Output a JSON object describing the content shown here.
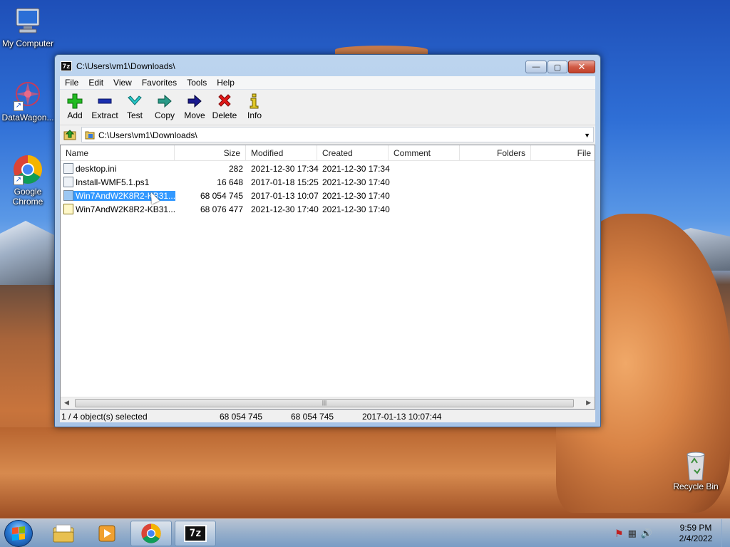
{
  "desktop": {
    "icons": [
      {
        "label": "My Computer",
        "icon": "computer-icon"
      },
      {
        "label": "DataWagon...",
        "icon": "datawagon-icon"
      },
      {
        "label": "Google Chrome",
        "icon": "chrome-icon"
      },
      {
        "label": "Recycle Bin",
        "icon": "recycle-bin-icon"
      }
    ]
  },
  "window": {
    "title": "C:\\Users\\vm1\\Downloads\\",
    "app_icon_text": "7z",
    "menu": [
      "File",
      "Edit",
      "View",
      "Favorites",
      "Tools",
      "Help"
    ],
    "toolbar": [
      {
        "label": "Add",
        "icon": "add-icon",
        "color": "#22aa22"
      },
      {
        "label": "Extract",
        "icon": "extract-icon",
        "color": "#1a2fa8"
      },
      {
        "label": "Test",
        "icon": "test-icon",
        "color": "#1cb5b5"
      },
      {
        "label": "Copy",
        "icon": "copy-icon",
        "color": "#1a8a7a"
      },
      {
        "label": "Move",
        "icon": "move-icon",
        "color": "#1a1a8a"
      },
      {
        "label": "Delete",
        "icon": "delete-icon",
        "color": "#d01818"
      },
      {
        "label": "Info",
        "icon": "info-icon",
        "color": "#d8c020"
      }
    ],
    "address": "C:\\Users\\vm1\\Downloads\\",
    "columns": [
      "Name",
      "Size",
      "Modified",
      "Created",
      "Comment",
      "Folders",
      "File"
    ],
    "files": [
      {
        "name": "desktop.ini",
        "size": "282",
        "modified": "2021-12-30 17:34",
        "created": "2021-12-30 17:34",
        "selected": false
      },
      {
        "name": "Install-WMF5.1.ps1",
        "size": "16 648",
        "modified": "2017-01-18 15:25",
        "created": "2021-12-30 17:40",
        "selected": false
      },
      {
        "name": "Win7AndW2K8R2-KB31...",
        "size": "68 054 745",
        "modified": "2017-01-13 10:07",
        "created": "2021-12-30 17:40",
        "selected": true
      },
      {
        "name": "Win7AndW2K8R2-KB31...",
        "size": "68 076 477",
        "modified": "2021-12-30 17:40",
        "created": "2021-12-30 17:40",
        "selected": false
      }
    ],
    "status": {
      "selection": "1 / 4 object(s) selected",
      "size": "68 054 745",
      "packed": "68 054 745",
      "date": "2017-01-13 10:07:44"
    }
  },
  "taskbar": {
    "apps": [
      "windows-explorer-icon",
      "media-player-icon",
      "chrome-icon",
      "7zip-icon"
    ],
    "app_7z_text": "7z",
    "time": "9:59 PM",
    "date": "2/4/2022"
  }
}
